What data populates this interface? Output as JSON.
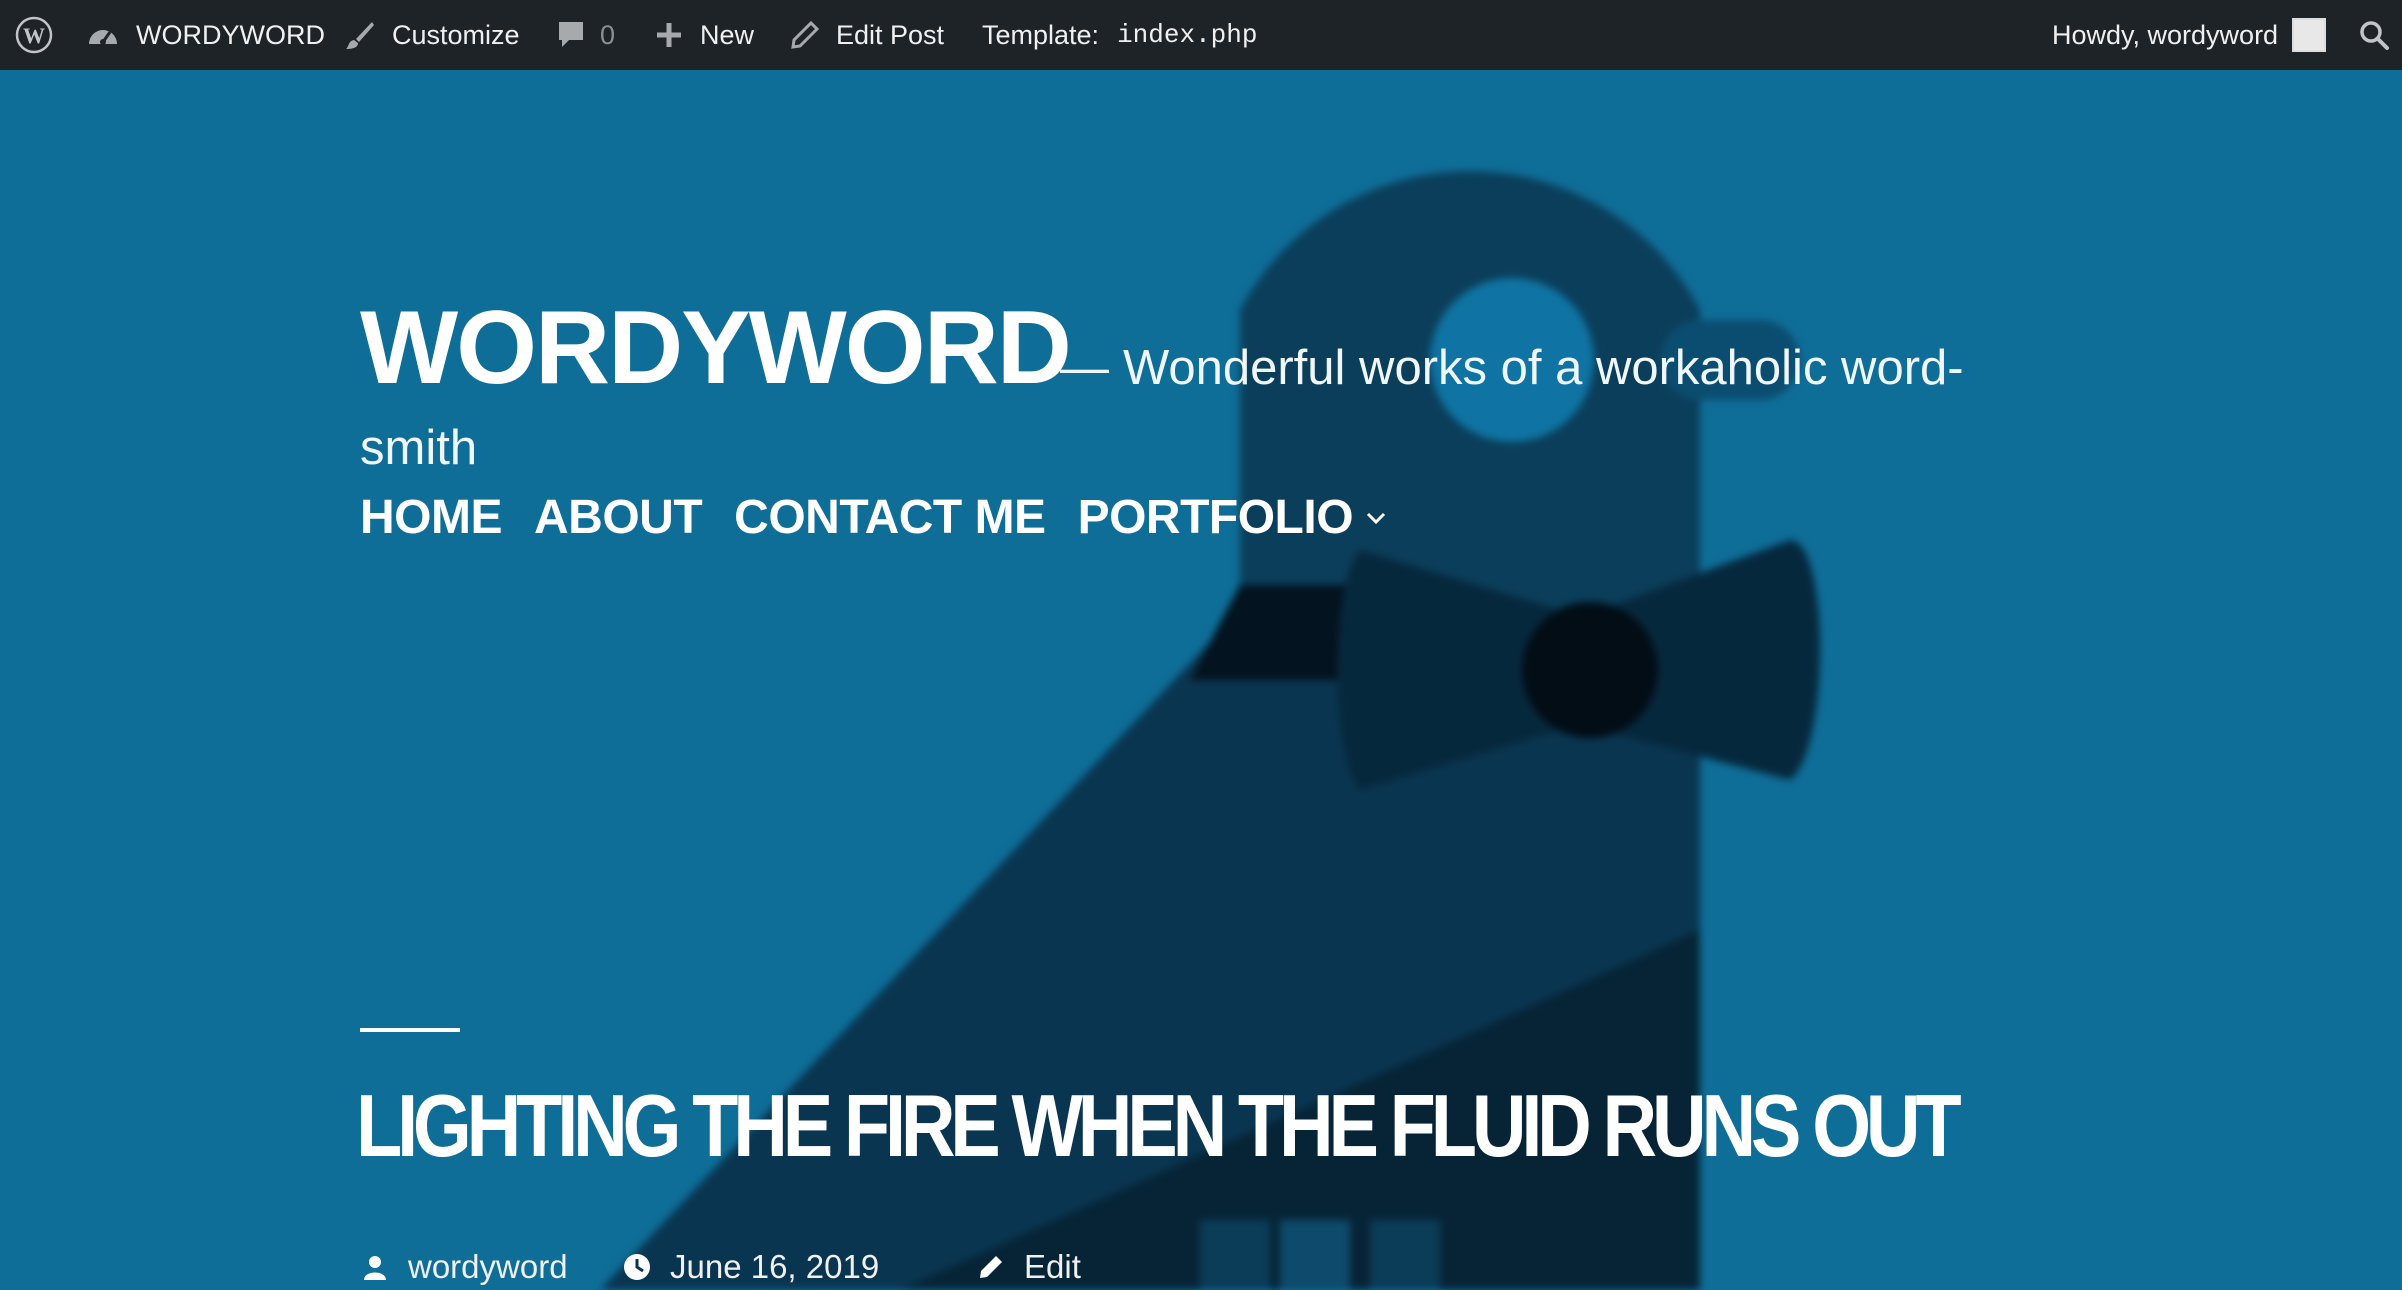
{
  "admin_bar": {
    "site_name": "WORDYWORD",
    "customize_label": "Customize",
    "comments_count": "0",
    "new_label": "New",
    "edit_post_label": "Edit Post",
    "template_label": "Template:",
    "template_file": "index.php",
    "howdy_label": "Howdy, wordyword",
    "icons": [
      "wordpress-logo-icon",
      "dashboard-icon",
      "brush-icon",
      "comment-bubble-icon",
      "plus-icon",
      "pencil-icon",
      "search-icon"
    ]
  },
  "header": {
    "site_title": "WORDYWORD",
    "description_dash": "—",
    "description": "Wonderful works of a workaholic word-smith"
  },
  "nav": {
    "items": [
      {
        "label": "HOME"
      },
      {
        "label": "ABOUT"
      },
      {
        "label": "CONTACT ME"
      },
      {
        "label": "PORTFOLIO",
        "has_submenu": true
      }
    ]
  },
  "post": {
    "title": "LIGHTING THE FIRE WHEN THE FLUID RUNS OUT",
    "author": "wordyword",
    "date": "June 16, 2019",
    "edit_label": "Edit"
  },
  "colors": {
    "admin_bar_bg": "#1d2327",
    "hero_bg": "#0f6e98",
    "bird_dark": "#062e44"
  }
}
